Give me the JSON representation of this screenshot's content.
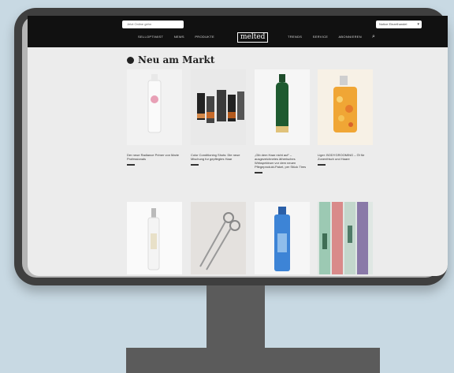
{
  "header": {
    "search_placeholder": "Jetzt Online gehn",
    "country_select": "Notice Einzelhandel",
    "logo": "melted",
    "menu_left": [
      "SELLOPTIMIST",
      "NEWS",
      "PRODUKTE"
    ],
    "menu_right": [
      "TRENDS",
      "SERVICE",
      "ABONNIEREN"
    ]
  },
  "section": {
    "title": "Neu am Markt"
  },
  "products": [
    {
      "caption": "Der neue Radiance Primer von Marie Professionals",
      "icon": "cosmetic-bottle"
    },
    {
      "caption": "Color Conditioning Shots: Die neue Mischung fur gepflegtes Haar",
      "icon": "product-set"
    },
    {
      "caption": "„Gib dem Haar nicht auf“ – ausgezeichnetes ätherisches Wirkspektrum vor dem neuen Pflegeprodukt-Paket, per Stück Tires",
      "icon": "green-bottle"
    },
    {
      "caption": "Liger: BODYGROOMING – Öl für Zonenfrisch und Haare",
      "icon": "oil-bottle"
    }
  ],
  "row2": [
    {
      "icon": "spray-bottle"
    },
    {
      "icon": "scissors"
    },
    {
      "icon": "blue-bottle"
    },
    {
      "icon": "color-swatches"
    }
  ]
}
